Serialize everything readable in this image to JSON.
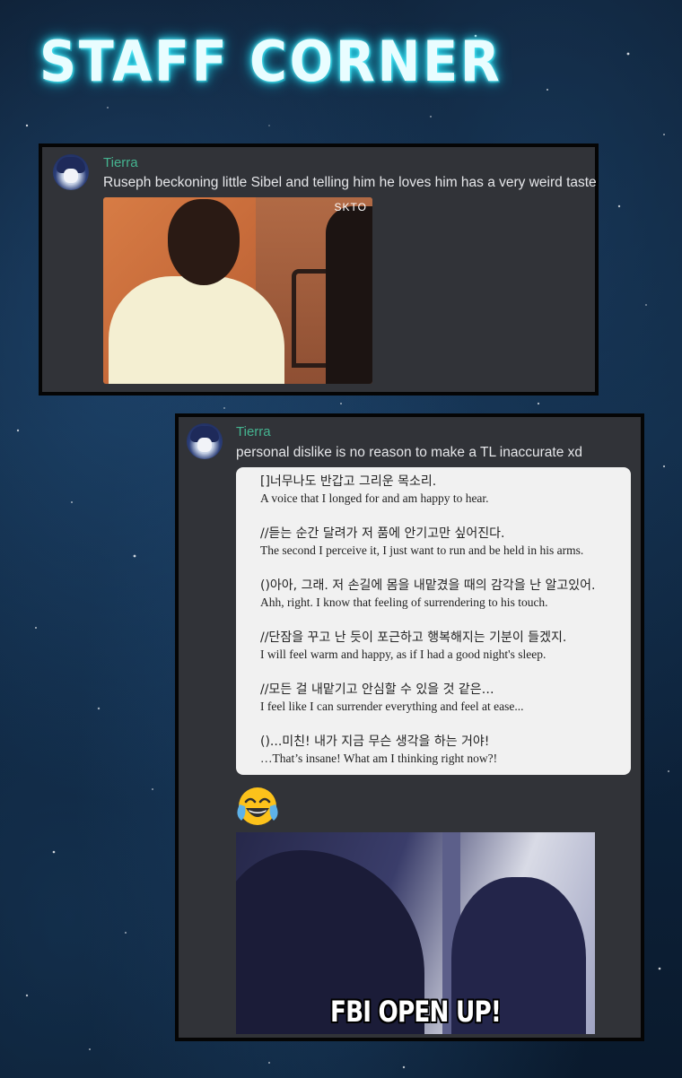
{
  "header": {
    "title": "STAFF CORNER"
  },
  "posts": [
    {
      "username": "Tierra",
      "text": "Ruseph beckoning little Sibel and telling him he loves him has a very weird taste",
      "image": {
        "watermark": "SKTO"
      }
    },
    {
      "username": "Tierra",
      "text": "personal dislike is no reason to make a TL inaccurate xd",
      "translation": [
        {
          "ko": "[]너무나도 반갑고 그리운 목소리.",
          "en": "A voice that I longed for and am happy to hear."
        },
        {
          "ko": "//듣는 순간 달려가 저 품에 안기고만 싶어진다.",
          "en": "The second I perceive it, I just want to run and be held in his arms."
        },
        {
          "ko": "()아아, 그래. 저 손길에 몸을 내맡겼을 때의 감각을 난 알고있어.",
          "en": "Ahh, right. I know that feeling of surrendering to his touch."
        },
        {
          "ko": "//단잠을 꾸고 난 듯이 포근하고 행복해지는 기분이 들겠지.",
          "en": "I will feel warm and happy, as if I had a good night's sleep."
        },
        {
          "ko": "//모든 걸 내맡기고 안심할 수 있을 것 같은…",
          "en": "I feel like I can surrender everything and feel at ease..."
        },
        {
          "ko": "()...미친! 내가 지금 무슨 생각을 하는 거야!",
          "en": "…That’s insane! What am I thinking right now?!"
        }
      ],
      "emoji": "face-with-tears-of-joy",
      "image": {
        "caption": "FBI OPEN UP!"
      }
    }
  ],
  "colors": {
    "username": "#45b490",
    "card_bg": "#313338",
    "title_glow": "#2fd9ef"
  }
}
